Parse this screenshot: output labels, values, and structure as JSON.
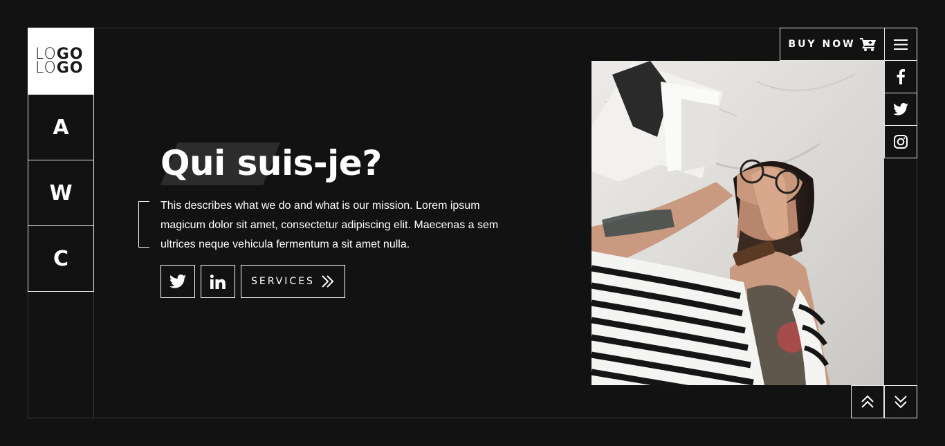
{
  "logo": {
    "line1_light": "LO",
    "line1_bold": "GO",
    "line2_light": "LO",
    "line2_bold": "GO"
  },
  "nav": {
    "items": [
      {
        "label": "A"
      },
      {
        "label": "W"
      },
      {
        "label": "C"
      }
    ]
  },
  "hero": {
    "title": "Qui suis-je?",
    "description": "This describes what we do and what is our mission. Lorem ipsum magicum dolor sit amet, consectetur adipiscing elit. Maecenas a sem ultrices neque vehicula fermentum a sit amet nulla.",
    "services_label": "SERVICES"
  },
  "header": {
    "buy_now_label": "BUY NOW"
  },
  "icons": {
    "twitter": "twitter-icon",
    "linkedin": "linkedin-icon",
    "services_arrow": "double-chevron-right-icon",
    "cart": "cart-icon",
    "menu": "hamburger-menu-icon",
    "facebook": "facebook-icon",
    "instagram": "instagram-icon",
    "scroll_up": "double-chevron-up-icon",
    "scroll_down": "double-chevron-down-icon"
  },
  "colors": {
    "background": "#121213",
    "border": "#3a3a3a",
    "foreground": "#ffffff",
    "title_accent": "#2c2c2c"
  }
}
